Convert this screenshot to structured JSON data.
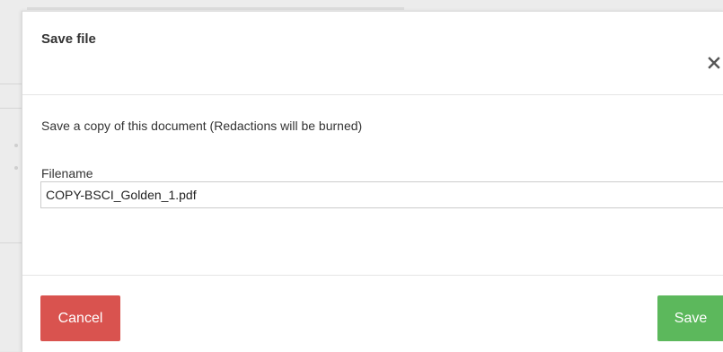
{
  "dialog": {
    "title": "Save file",
    "close_icon": "close-icon",
    "message": "Save a copy of this document (Redactions will be burned)",
    "filename_label": "Filename",
    "filename_value": "COPY-BSCI_Golden_1.pdf",
    "cancel_label": "Cancel",
    "save_label": "Save"
  },
  "colors": {
    "cancel": "#d9534f",
    "save": "#5cb85c"
  }
}
